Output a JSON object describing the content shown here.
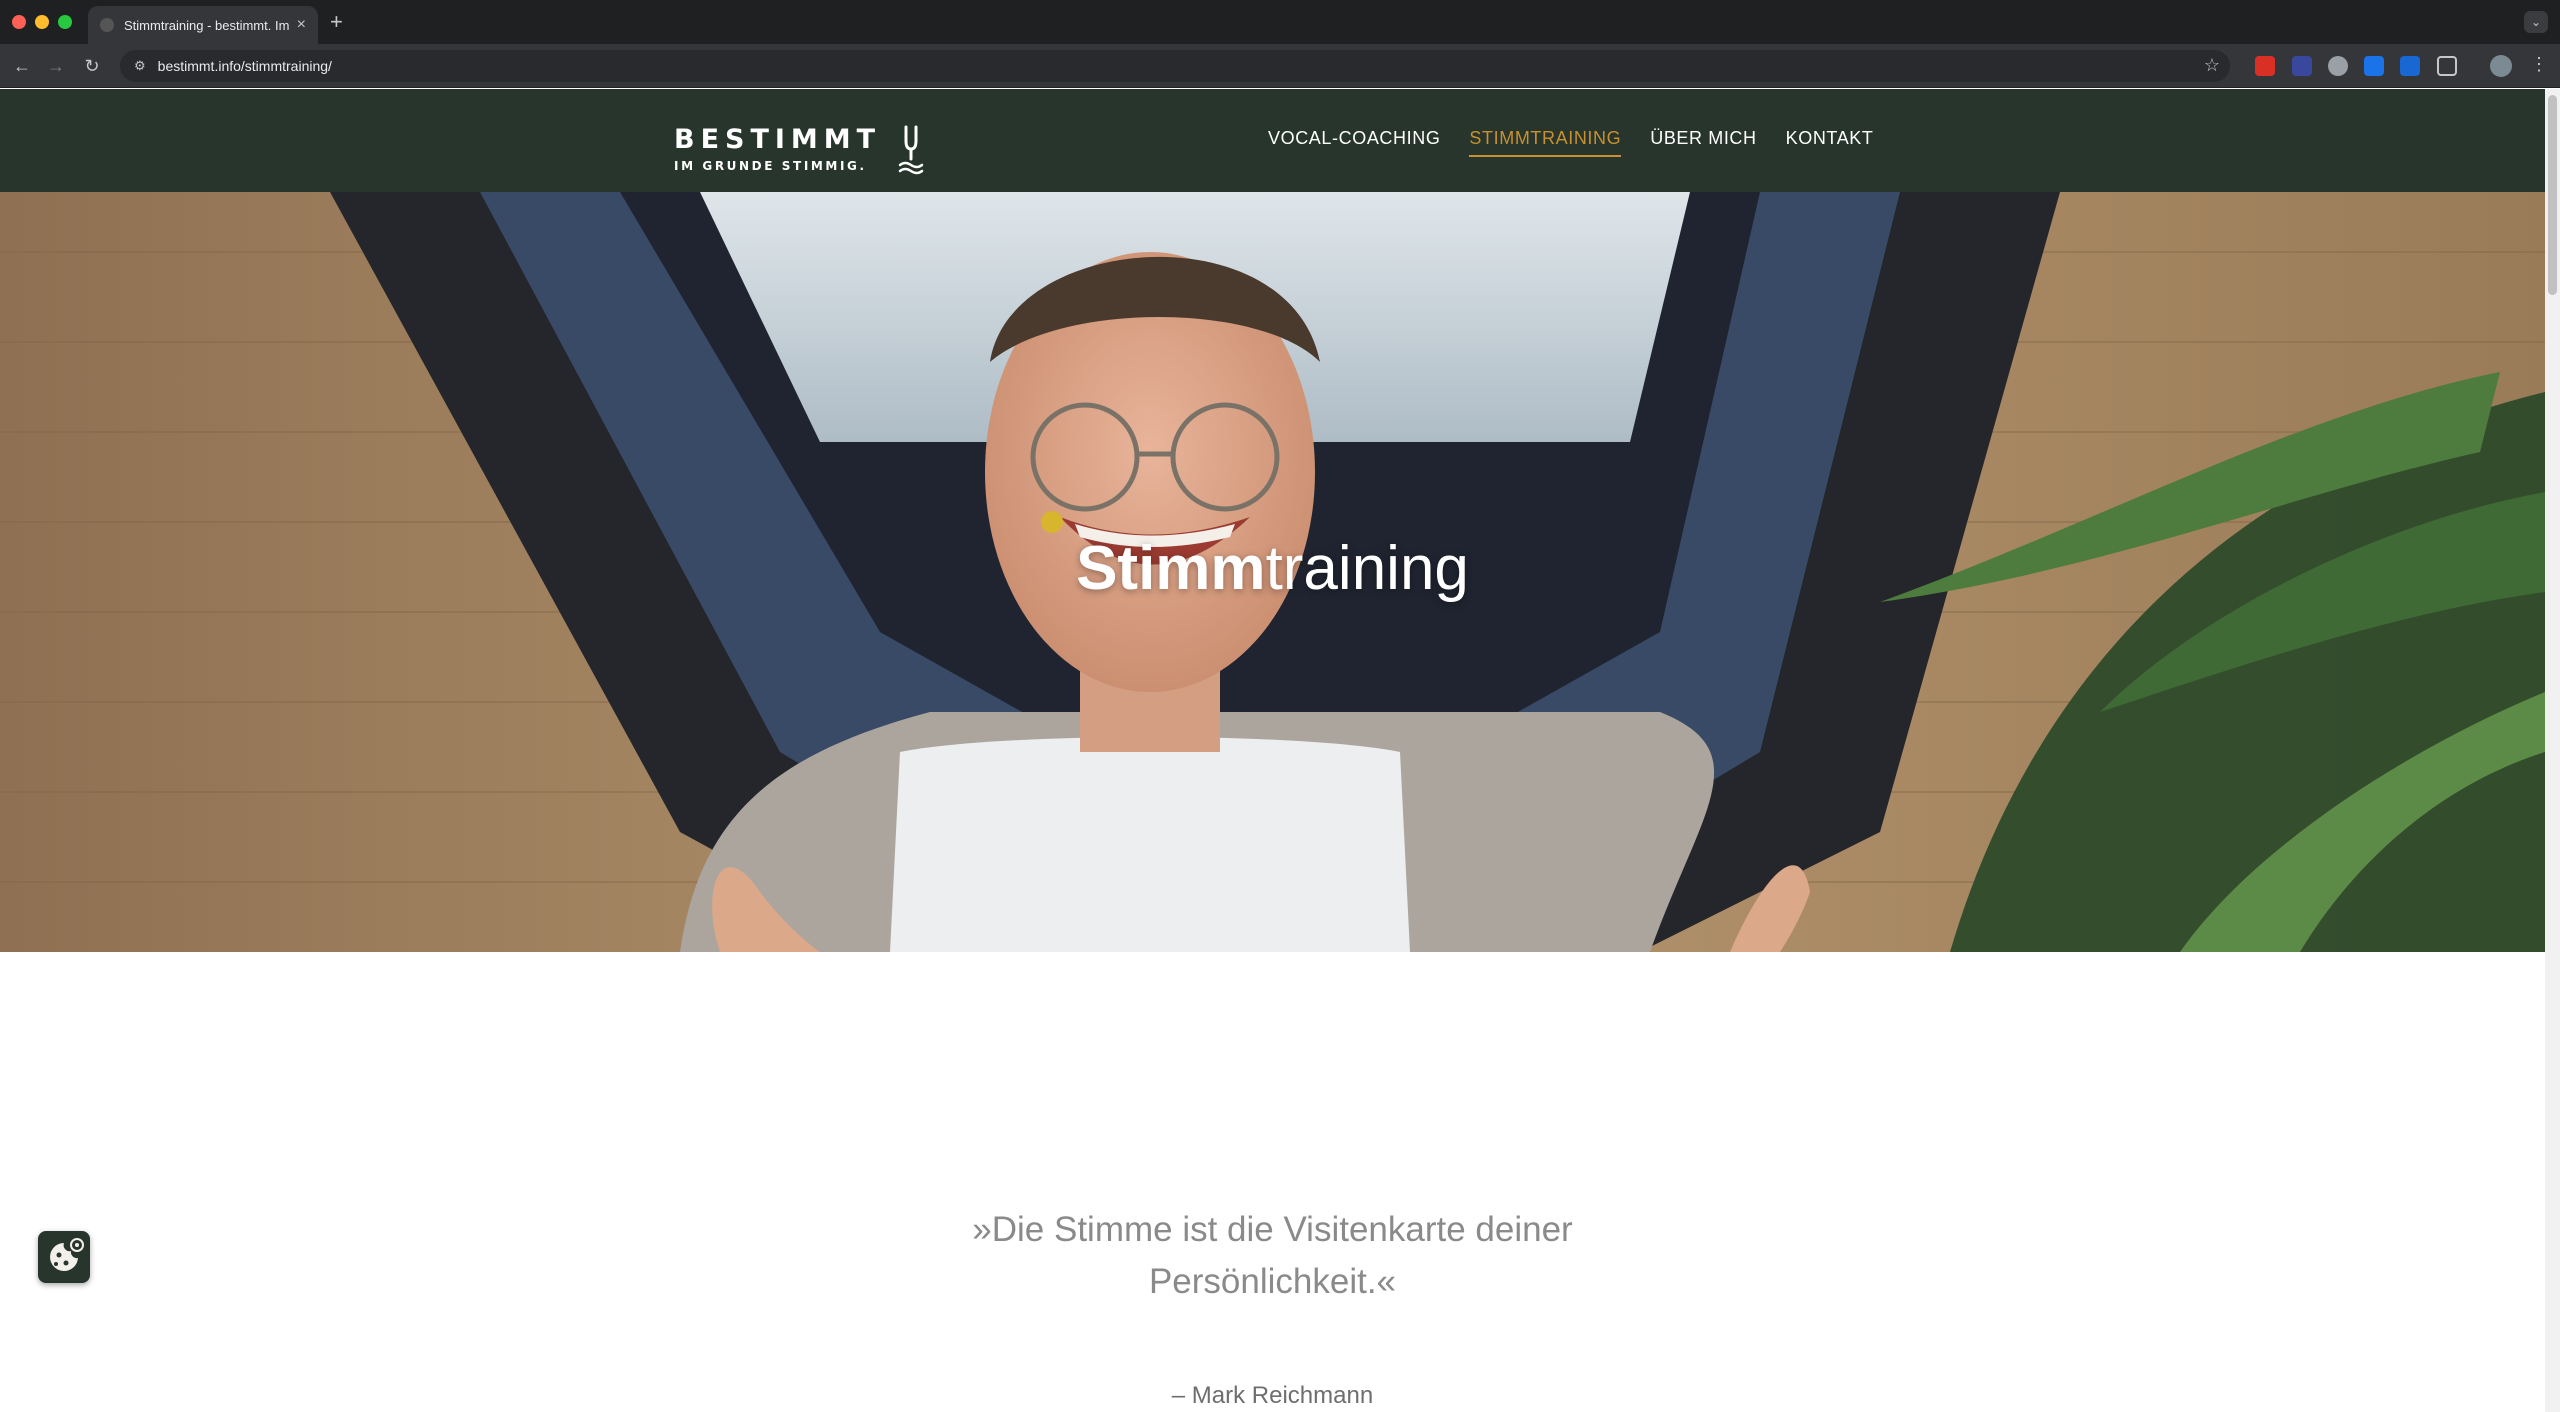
{
  "browser": {
    "tab_title": "Stimmtraining - bestimmt. Im",
    "new_tab": "+",
    "tab_close": "×",
    "url": "bestimmt.info/stimmtraining/"
  },
  "header": {
    "logo_main": "BESTIMMT",
    "logo_sub": "IM GRUNDE STIMMIG.",
    "nav": [
      "VOCAL-COACHING",
      "STIMMTRAINING",
      "ÜBER MICH",
      "KONTAKT"
    ],
    "active_nav": "STIMMTRAINING",
    "accent_color": "#c8902e",
    "header_color": "#27352c"
  },
  "hero": {
    "title_bold": "Stimm",
    "title_light": "training"
  },
  "quote": {
    "line1": "»Die Stimme ist die Visitenkarte deiner",
    "line2": "Persönlichkeit.«",
    "author": "– Mark Reichmann"
  },
  "icons": {
    "cookie": "cookie-settings-icon",
    "logo_mark": "tuning-fork-icon"
  }
}
